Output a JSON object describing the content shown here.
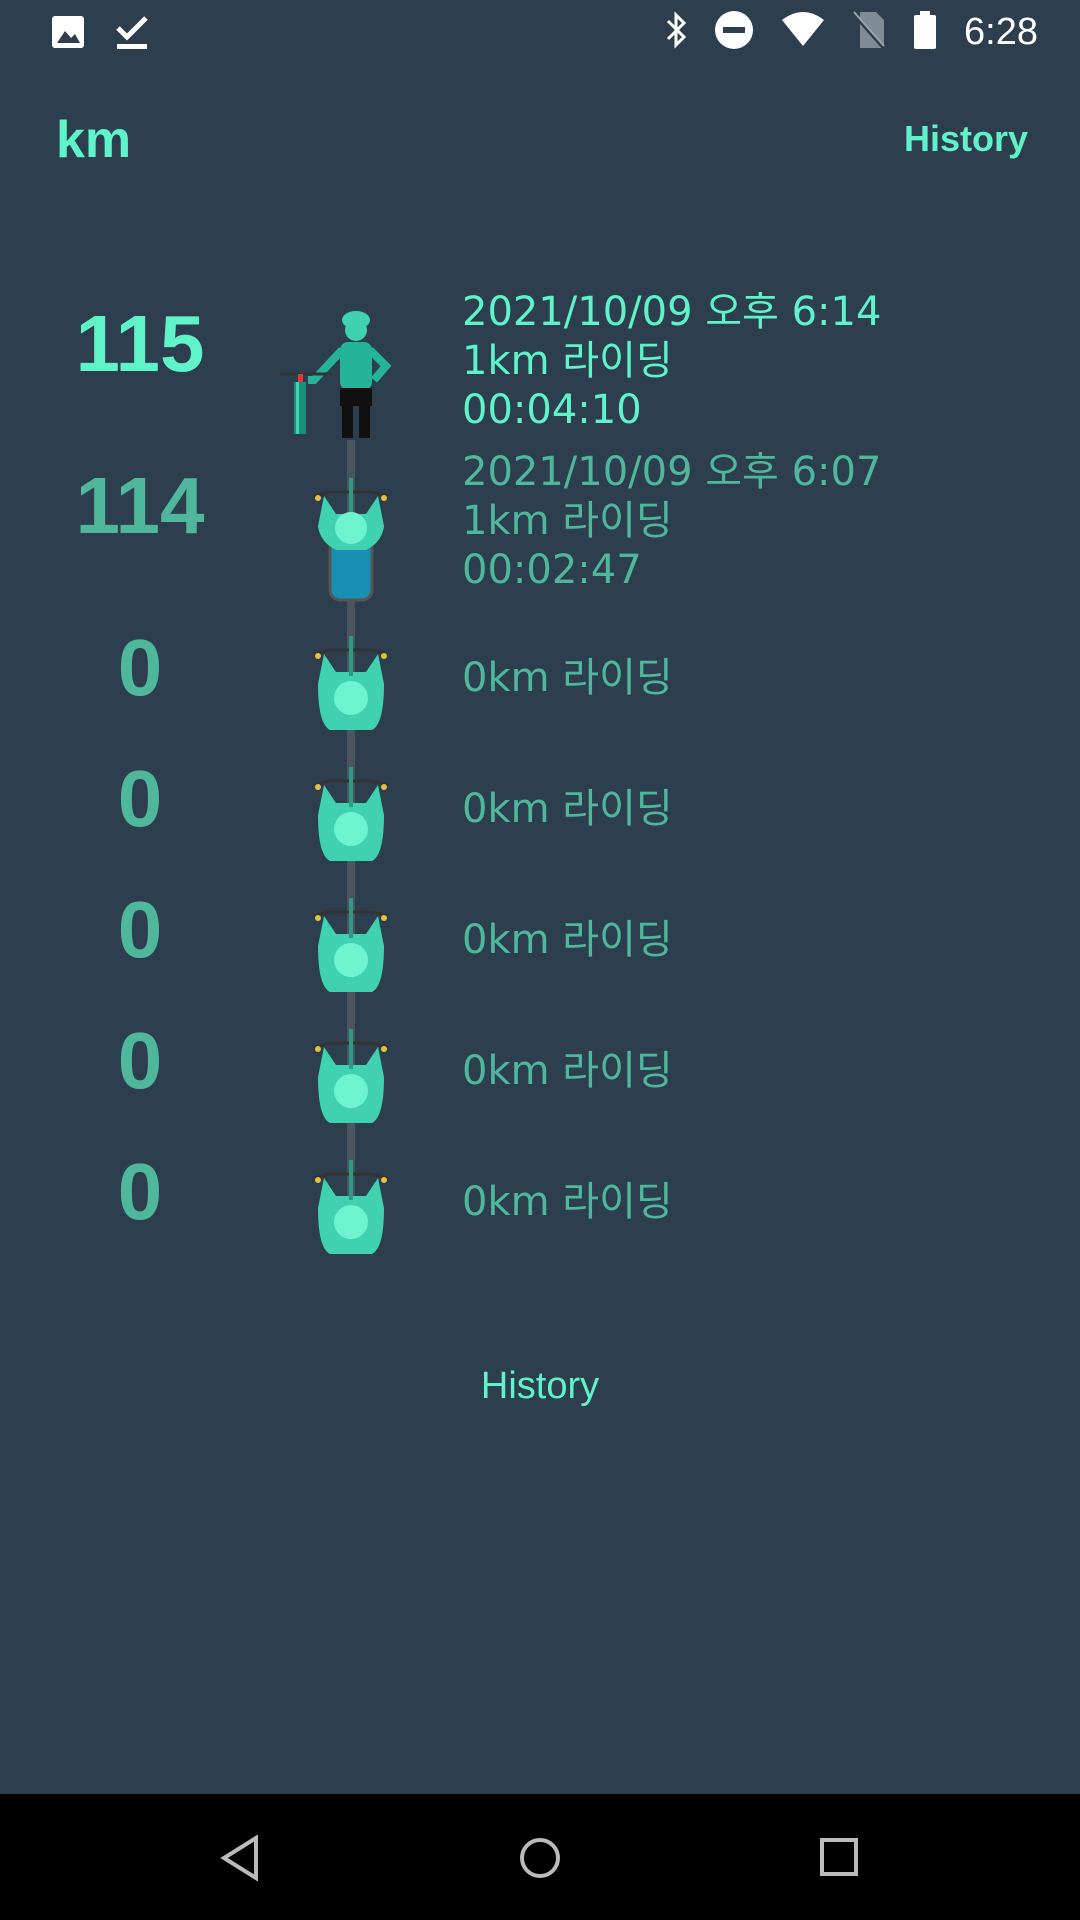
{
  "status_bar": {
    "time": "6:28",
    "left_icons": [
      "image-icon",
      "download-done-icon"
    ],
    "right_icons": [
      "bluetooth-icon",
      "do-not-disturb-icon",
      "wifi-icon",
      "no-sim-icon",
      "battery-icon"
    ]
  },
  "header": {
    "title": "km",
    "history_label": "History"
  },
  "rides": [
    {
      "km": "115",
      "date": "2021/10/09 오후 6:14",
      "distance": "1km 라이딩",
      "duration": "00:04:10"
    },
    {
      "km": "114",
      "date": "2021/10/09 오후 6:07",
      "distance": "1km 라이딩",
      "duration": "00:02:47"
    },
    {
      "km": "0",
      "distance": "0km 라이딩"
    },
    {
      "km": "0",
      "distance": "0km 라이딩"
    },
    {
      "km": "0",
      "distance": "0km 라이딩"
    },
    {
      "km": "0",
      "distance": "0km 라이딩"
    },
    {
      "km": "0",
      "distance": "0km 라이딩"
    }
  ],
  "footer": {
    "history_link": "History"
  },
  "colors": {
    "background": "#2d3e4f",
    "accent": "#5ef3c9",
    "muted": "#4fb89c",
    "navbar": "#000000"
  }
}
